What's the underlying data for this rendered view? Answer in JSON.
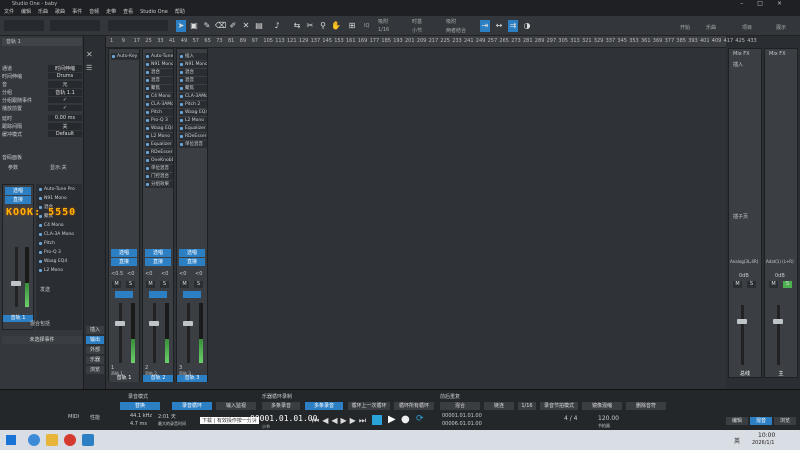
{
  "window": {
    "title": "Studio One - baby"
  },
  "menu": [
    "文件",
    "编辑",
    "乐曲",
    "歌曲",
    "事件",
    "音频",
    "走带",
    "查看",
    "Studio One",
    "帮助"
  ],
  "toolbar": {
    "quantize_label": "IQ",
    "snap_label": "吸附",
    "quantize_value": "1/16",
    "timebase_label": "时基",
    "timebase_value": "小节",
    "snap_label2": "吸附",
    "snap_value": "两者结合",
    "start_label": "开始",
    "song_label": "乐曲",
    "project_label": "项目",
    "show_label": "展示",
    "user_label": "登录",
    "bpm_label": "播放"
  },
  "inspector": {
    "track_name": "音轨 1",
    "rows": [
      {
        "label": "通道",
        "value": "时间伸缩"
      },
      {
        "label": "时间伸缩",
        "value": "Drums"
      },
      {
        "label": "音",
        "value": "元"
      },
      {
        "label": "分组",
        "value": "音轨 1.1"
      },
      {
        "label": "分组跟随事件",
        "value": "✓"
      },
      {
        "label": "播放前置",
        "value": "✓"
      },
      {
        "label": "延时",
        "value": "0.00 ms"
      },
      {
        "label": "跟踪间隔",
        "value": "关"
      },
      {
        "label": "缓冲模式",
        "value": "Default"
      }
    ],
    "section_label": "音码面板",
    "ref_label": "参数",
    "display_label": "显示:关",
    "channel_labels": {
      "route": "选唱",
      "dir": "直接",
      "insert": "插入",
      "send": "发送",
      "name": "音轨 1",
      "mode": "混合包括",
      "mode2": "未选择事件"
    },
    "plugins": [
      "Auto-Tune Pro",
      "N91 Mono",
      "混合",
      "聚焦",
      "C4 Mono",
      "CLA-3A Mono",
      "Pitch",
      "Pro-Q 3",
      "Waag EQ4",
      "L2 Mono"
    ],
    "watermark": "KOOK: 5550"
  },
  "leftcol": {
    "labels": [
      "插入",
      "输出",
      "外部",
      "乐器",
      "浏览"
    ]
  },
  "ruler": {
    "ticks": [
      "1",
      "9",
      "17",
      "25",
      "33",
      "41",
      "49",
      "57",
      "65",
      "73",
      "81",
      "89",
      "97",
      "105",
      "113",
      "121",
      "129",
      "137",
      "145",
      "153",
      "161",
      "169",
      "177",
      "185",
      "193",
      "201",
      "209",
      "217",
      "225",
      "233",
      "241",
      "249",
      "257",
      "265",
      "273",
      "281",
      "289",
      "297",
      "305",
      "313",
      "321",
      "329",
      "337",
      "345",
      "353",
      "361",
      "369",
      "377",
      "385",
      "393",
      "401",
      "409",
      "417",
      "425",
      "433"
    ]
  },
  "channels": [
    {
      "name": "音轨 1",
      "plugins": [
        "Auto-Key"
      ],
      "route": "选唱",
      "dir": "直接",
      "vol": "<0.5",
      "pan": "<0",
      "num": "1",
      "mode": "声轨 1"
    },
    {
      "name": "音轨 2",
      "plugins": [
        "Auto-TuneP",
        "N91 Mono",
        "混合",
        "混音",
        "聚焦",
        "C4 Mono",
        "CLA-3AMono",
        "Pitch",
        "Pro-Q 3",
        "Waag EQ4",
        "L2 Mono",
        "Equalizer",
        "RDeEsserMo",
        "OneKnobDri",
        "单位混音",
        "门控混合",
        "分组效果"
      ],
      "route": "选唱",
      "dir": "直接",
      "vol": "<0",
      "pan": "<0",
      "num": "2",
      "mode": "声轨 2"
    },
    {
      "name": "音轨 3",
      "plugins": [
        "插入",
        "N91 Mono",
        "混合",
        "混音",
        "聚焦",
        "CLA-3AMono",
        "Pitch 2",
        "Waag EQ4",
        "L2 Mono",
        "Equalizer",
        "RDeEsserMo",
        "单位混音"
      ],
      "route": "选唱",
      "dir": "直接",
      "vol": "<0",
      "pan": "<0",
      "num": "3",
      "mode": "声轨 3"
    }
  ],
  "right_mixer": {
    "fx1": "Mix FX",
    "fx2": "Mix FX",
    "insert": "插入",
    "send": "插子页",
    "out1": "Analog(3L,4R)",
    "out2": "Adat(1) (L+R)",
    "vol1": "0dB",
    "vol2": "0dB",
    "m": "M",
    "s": "S",
    "name1": "总线",
    "name2": "主"
  },
  "transport": {
    "record_mode_label": "录音模式",
    "record_mode": "替换",
    "cycle_label": "录音循环",
    "input_label": "输入监视",
    "loop_label": "乐器循环录制",
    "loop_value": "多条录音",
    "loop2": "循环上一次循环",
    "loop3": "循环所有循环",
    "pre_label": "前后重复",
    "mixer": "混合",
    "sync": "链连",
    "quant": "1/16",
    "match": "录音节拍模式",
    "auto": "镜像混缩",
    "del": "删除音符",
    "sample_rate": "44.1 kHz",
    "latency": "4.7 ms",
    "time_elapsed": "2:01 天",
    "free": "最大的录音时间",
    "time_main": "00001.01.01.00",
    "time_sub": "小节",
    "loop_start": "00001.01.01.00",
    "loop_end": "00006.01.01.00",
    "sig": "4 / 4",
    "tempo": "120.00",
    "tempo_label": "节拍器",
    "midi_label": "MIDI",
    "perf_label": "性能",
    "tooltip": "下载 | 有效操作按一分钟",
    "edit_btn": "编辑",
    "mix_btn": "混音",
    "browse_btn": "浏览"
  },
  "taskbar": {
    "lang": "英",
    "time": "10:00",
    "date": "2026/1/1"
  }
}
